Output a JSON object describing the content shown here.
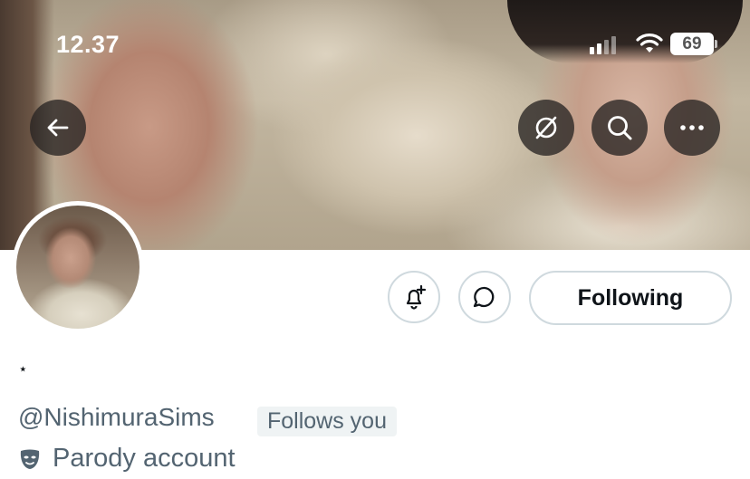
{
  "status_bar": {
    "time": "12.37",
    "battery": "69"
  },
  "profile": {
    "display_name": "⋆",
    "handle": "@NishimuraSims",
    "follows_you": "Follows you",
    "parody_label": "Parody account"
  },
  "actions": {
    "following_label": "Following"
  },
  "icons": {
    "back": "arrow-left-icon",
    "translate": "translate-off-icon",
    "search": "search-icon",
    "more": "more-icon",
    "notify": "bell-plus-icon",
    "message": "message-bubble-icon",
    "parody": "mask-icon"
  }
}
